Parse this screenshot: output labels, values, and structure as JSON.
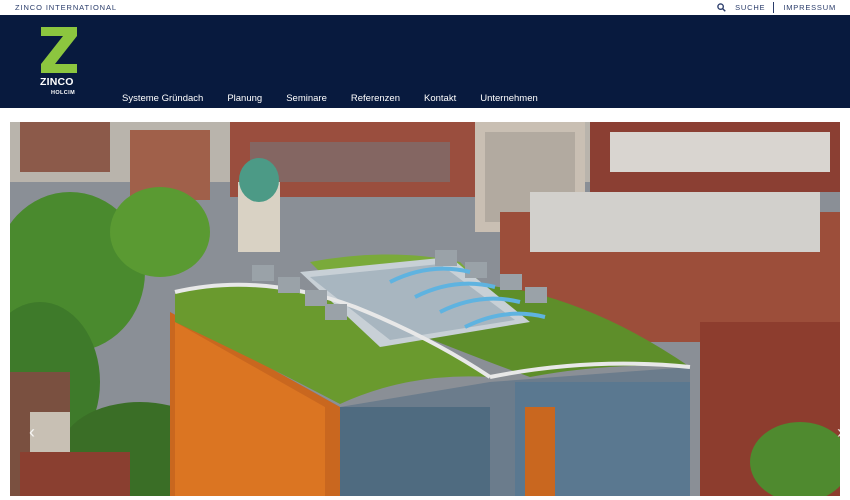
{
  "topbar": {
    "brand": "ZINCO INTERNATIONAL",
    "search_label": "SUCHE",
    "imprint_label": "IMPRESSUM"
  },
  "logo": {
    "name": "ZINCO",
    "sub": "HOLCIM"
  },
  "nav": {
    "items": [
      {
        "label": "Systeme Gründach"
      },
      {
        "label": "Planung"
      },
      {
        "label": "Seminare"
      },
      {
        "label": "Referenzen"
      },
      {
        "label": "Kontakt"
      },
      {
        "label": "Unternehmen"
      }
    ]
  },
  "hero": {
    "prev_icon": "chevron-left-icon",
    "next_icon": "chevron-right-icon"
  },
  "colors": {
    "header_bg": "#081a3e",
    "logo_green": "#8cc63f",
    "topbar_text": "#2a3c6a"
  }
}
